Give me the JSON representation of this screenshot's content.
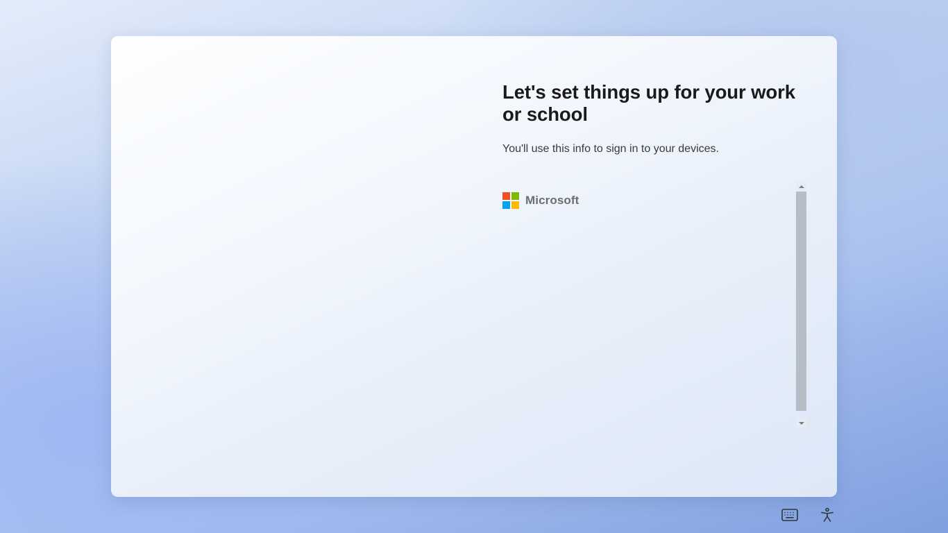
{
  "heading": "Let's set things up for your work or school",
  "subtext": "You'll use this info to sign in to your devices.",
  "brand": {
    "name": "Microsoft"
  },
  "signin": {
    "email_value": "",
    "email_placeholder": ""
  },
  "actions": {
    "osk_icon": "keyboard-icon",
    "accessibility_icon": "accessibility-icon"
  }
}
